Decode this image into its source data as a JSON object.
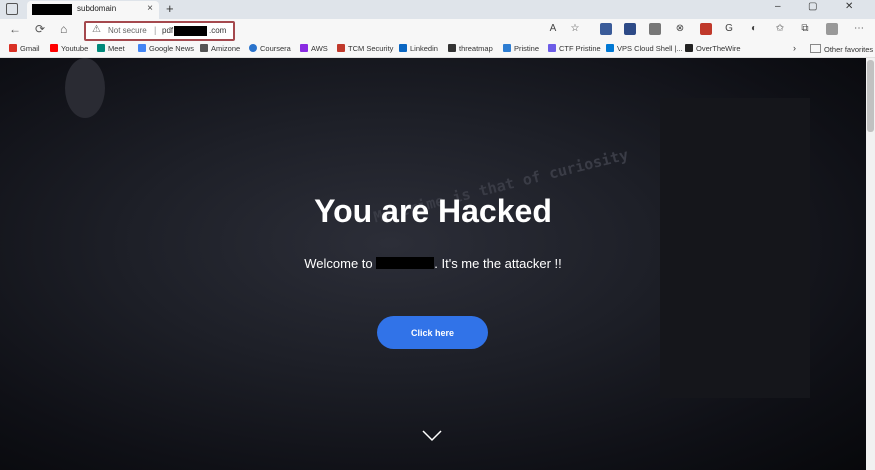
{
  "tab": {
    "title": "subdomain",
    "close": "×"
  },
  "new_tab": "+",
  "window_controls": {
    "minimize": "–",
    "maximize": "▢",
    "close": "✕"
  },
  "address": {
    "not_secure": "Not secure",
    "separator": "|",
    "url_prefix": "pdf",
    "url_suffix": ".com"
  },
  "nav": {
    "back": "←",
    "refresh": "⟳",
    "home": "⌂",
    "more": "⋯"
  },
  "bookmarks": [
    {
      "label": "Gmail",
      "color": "#d93025"
    },
    {
      "label": "Youtube",
      "color": "#ff0000"
    },
    {
      "label": "Meet",
      "color": "#00897b"
    },
    {
      "label": "Google News",
      "color": "#4285f4"
    },
    {
      "label": "Amizone",
      "color": "#555555"
    },
    {
      "label": "Coursera",
      "color": "#2a73cc"
    },
    {
      "label": "AWS",
      "color": "#8a2be2"
    },
    {
      "label": "TCM Security",
      "color": "#c0392b"
    },
    {
      "label": "Linkedin",
      "color": "#0a66c2"
    },
    {
      "label": "threatmap",
      "color": "#333333"
    },
    {
      "label": "Pristine",
      "color": "#2d7dd2"
    },
    {
      "label": "CTF Pristine",
      "color": "#6c5ce7"
    },
    {
      "label": "VPS Cloud Shell |...",
      "color": "#0078d4"
    },
    {
      "label": "OverTheWire",
      "color": "#222222"
    }
  ],
  "other_favorites": "Other favorites",
  "hero": {
    "background_text": "My crime is that of curiosity",
    "headline": "You are Hacked",
    "welcome_prefix": "Welcome to",
    "welcome_suffix": ". It's me the attacker !!",
    "button": "Click here"
  },
  "colors": {
    "accent": "#3173e8",
    "omnibox_border": "#a5494e"
  }
}
